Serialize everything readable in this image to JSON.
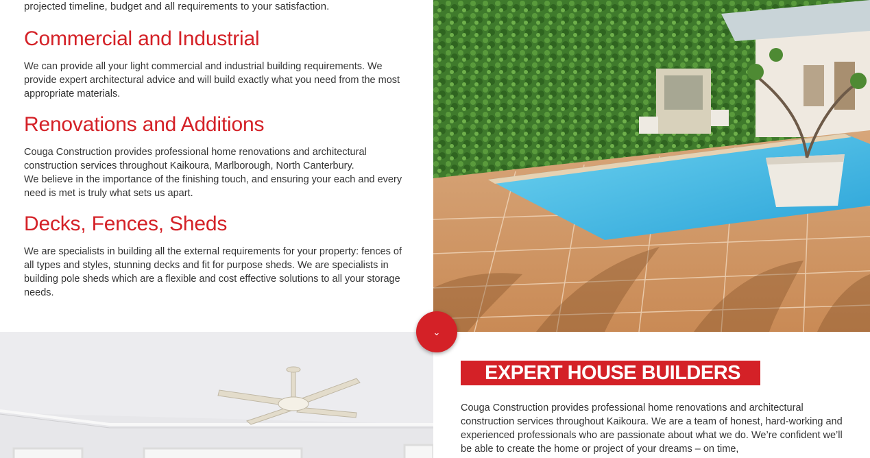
{
  "intro": {
    "tail": "projected timeline, budget and all requirements to your satisfaction."
  },
  "services": [
    {
      "title": "Commercial and Industrial",
      "paragraphs": [
        "We can provide all your light commercial and industrial building requirements. We provide expert architectural advice and will build exactly what you need from the most appropriate materials."
      ]
    },
    {
      "title": "Renovations and Additions",
      "paragraphs": [
        "Couga Construction provides professional home renovations and architectural construction services throughout Kaikoura, Marlborough, North Canterbury.",
        "We believe in the importance of the finishing touch, and ensuring your each and every need is met is truly what sets us apart."
      ]
    },
    {
      "title": "Decks, Fences, Sheds",
      "paragraphs": [
        "We are specialists in building all the external requirements for your property: fences of all types and styles, stunning decks and fit for purpose sheds. We are specialists in building pole sheds which are a flexible and cost effective solutions to all your storage needs."
      ]
    }
  ],
  "scroll_button": {
    "icon": "chevron-down-icon",
    "glyph": "⌄"
  },
  "expert": {
    "title": "EXPERT HOUSE BUILDERS",
    "body": "Couga Construction provides professional home renovations and architectural construction services throughout Kaikoura. We are a team of honest, hard-working and experienced professionals who are passionate about what we do. We’re confident we’ll be able to create the home or project of your dreams – on time,"
  },
  "colors": {
    "accent": "#d42127",
    "text": "#333333",
    "background": "#ffffff"
  }
}
